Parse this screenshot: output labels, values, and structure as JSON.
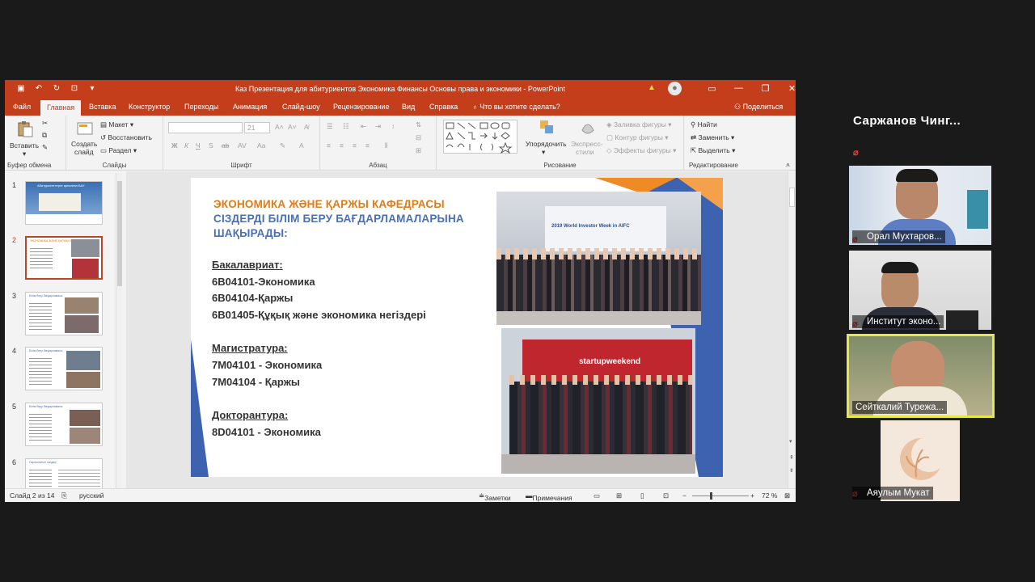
{
  "window": {
    "title": "Каз Презентация для абитуриентов Экономика Финансы Основы права и экономики  -  PowerPoint"
  },
  "tabs": [
    "Файл",
    "Главная",
    "Вставка",
    "Конструктор",
    "Переходы",
    "Анимация",
    "Слайд-шоу",
    "Рецензирование",
    "Вид",
    "Справка"
  ],
  "tell_me": "Что вы хотите сделать?",
  "share": "Поделиться",
  "ribbon": {
    "clipboard": {
      "paste": "Вставить",
      "label": "Буфер обмена"
    },
    "slides": {
      "new_slide_1": "Создать",
      "new_slide_2": "слайд",
      "layout": "Макет",
      "reset": "Восстановить",
      "section": "Раздел",
      "label": "Слайды"
    },
    "font": {
      "size": "21",
      "label": "Шрифт",
      "buttons": [
        "Ж",
        "К",
        "Ч",
        "S",
        "ab",
        "AV",
        "Aa"
      ]
    },
    "paragraph": {
      "label": "Абзац"
    },
    "drawing": {
      "arrange": "Упорядочить",
      "quick_styles_1": "Экспресс-",
      "quick_styles_2": "стили",
      "fill": "Заливка фигуры",
      "outline": "Контур фигуры",
      "effects": "Эффекты фигуры",
      "label": "Рисование"
    },
    "editing": {
      "find": "Найти",
      "replace": "Заменить",
      "select": "Выделить",
      "label": "Редактирование"
    }
  },
  "thumbnails": [
    {
      "num": "1",
      "title": "Абитуриенттерге арналған БАУ"
    },
    {
      "num": "2",
      "title": "ЭКОНОМИКА ЖӘНЕ ҚАРЖЫ КАФЕДРАСЫ"
    },
    {
      "num": "3",
      "title": "Білім беру бағдарламасы"
    },
    {
      "num": "4",
      "title": "Білім беру бағдарламасы"
    },
    {
      "num": "5",
      "title": "Білім беру бағдарламасы"
    },
    {
      "num": "6",
      "title": "Оқытылатын пәндер"
    }
  ],
  "slide": {
    "title_1": "ЭКОНОМИКА ЖӘНЕ ҚАРЖЫ КАФЕДРАСЫ",
    "title_2": "СІЗДЕРДІ БІЛІМ БЕРУ БАҒДАРЛАМАЛАРЫНА",
    "title_3": "ШАҚЫРАДЫ:",
    "bachelor_head": "Бакалавриат:",
    "bachelor": [
      "6В04101-Экономика",
      "6В04104-Қаржы",
      "6В01405-Құқық және экономика негіздері"
    ],
    "master_head": "Магистратура:",
    "master": [
      "7М04101 - Экономика",
      "7М04104 - Қаржы"
    ],
    "doctor_head": "Докторантура:",
    "doctor": [
      "8D04101 - Экономика"
    ],
    "photo1_banner": "2019 World Investor Week in AIFC",
    "photo2_banner": "startupweekend"
  },
  "status": {
    "slide_of": "Слайд 2 из 14",
    "lang": "русский",
    "notes": "Заметки",
    "comments": "Примечания",
    "zoom": "72 %"
  },
  "participants": {
    "host": "Саржанов Чинг...",
    "tiles": [
      "Орал Мухтаров...",
      "Институт эконо...",
      "Сейткалий Турежа...",
      "Аяулым Мукат"
    ]
  },
  "colors": {
    "titlebar": "#c43e1c",
    "slide_title_orange": "#e07b1a",
    "slide_title_blue": "#4a6fb5",
    "active_speaker": "#e6e64d"
  }
}
